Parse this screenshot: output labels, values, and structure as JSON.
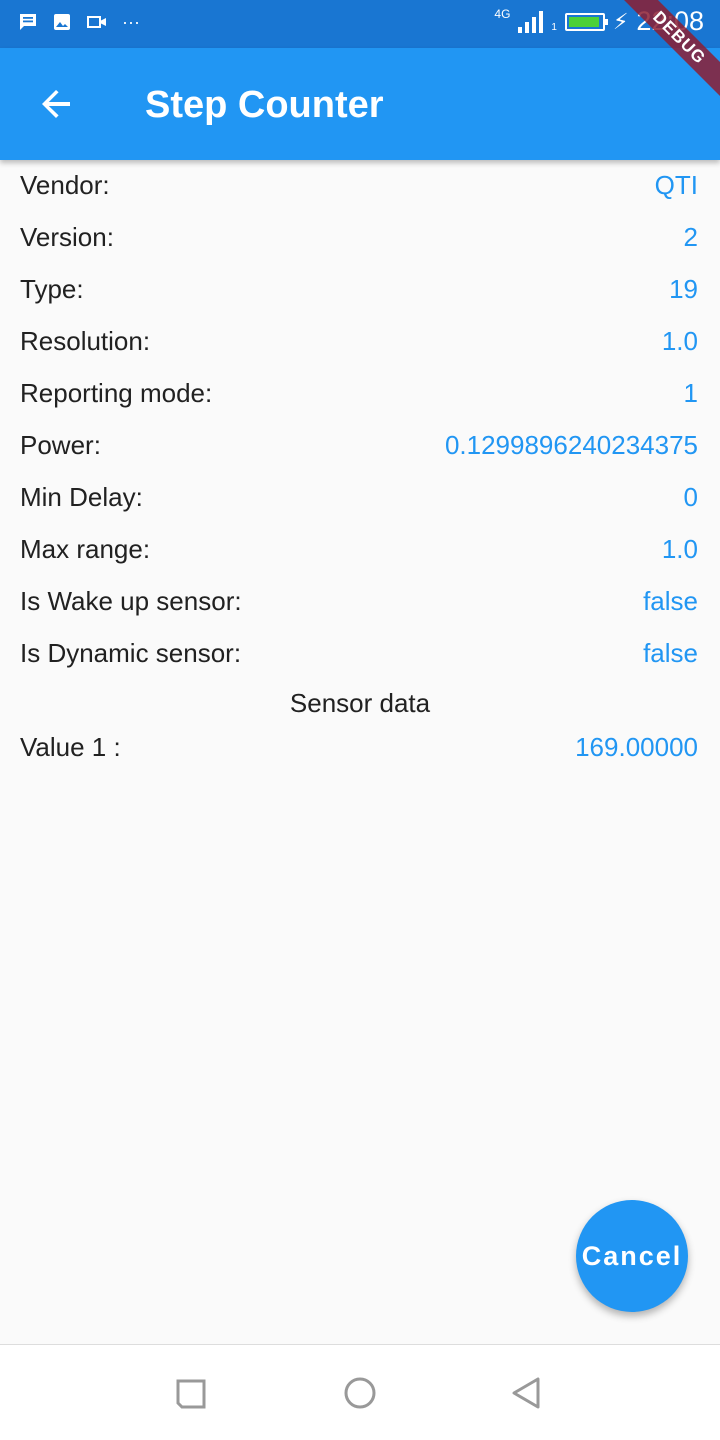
{
  "status_bar": {
    "icons": [
      "message-icon",
      "image-icon",
      "video-icon",
      "more-dots-icon"
    ],
    "more": "···",
    "network": "4G",
    "sim": "1",
    "battery_level": 0.95,
    "time": "22:08"
  },
  "debug_banner": "DEBUG",
  "app_bar": {
    "title": "Step Counter",
    "back_icon": "arrow-back-icon"
  },
  "sensor_info": [
    {
      "label": "Vendor:",
      "value": "QTI"
    },
    {
      "label": "Version:",
      "value": "2"
    },
    {
      "label": "Type:",
      "value": "19"
    },
    {
      "label": "Resolution:",
      "value": "1.0"
    },
    {
      "label": "Reporting mode:",
      "value": "1"
    },
    {
      "label": "Power:",
      "value": "0.1299896240234375"
    },
    {
      "label": "Min Delay:",
      "value": "0"
    },
    {
      "label": "Max range:",
      "value": "1.0"
    },
    {
      "label": "Is Wake up sensor:",
      "value": "false"
    },
    {
      "label": "Is Dynamic sensor:",
      "value": "false"
    }
  ],
  "sensor_data": {
    "title": "Sensor data",
    "values": [
      {
        "label": "Value 1 :",
        "value": "169.00000"
      }
    ]
  },
  "fab": {
    "label": "Cancel"
  },
  "colors": {
    "primary": "#2196f3",
    "status_bar": "#1976d2",
    "text": "#212121",
    "background": "#fafafa"
  }
}
